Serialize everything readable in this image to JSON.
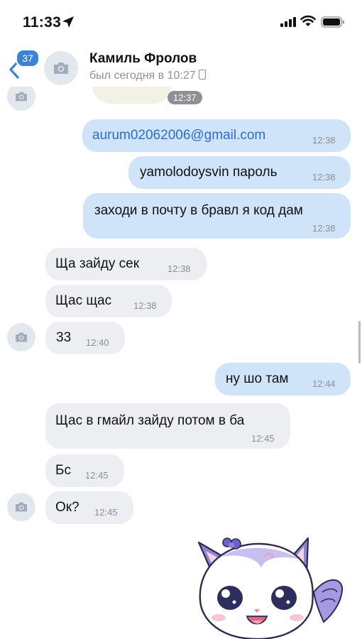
{
  "status_bar": {
    "time": "11:33"
  },
  "header": {
    "unread_badge": "37",
    "contact_name": "Камиль Фролов",
    "last_seen": "был сегодня в 10:27"
  },
  "chat": {
    "sticker_time": "12:37",
    "messages": [
      {
        "text": "aurum02062006@gmail.com",
        "time": "12:38"
      },
      {
        "text": "yamolodoysvin пароль",
        "time": "12:38"
      },
      {
        "text": "заходи в почту в бравл я код дам",
        "time": "12:38"
      },
      {
        "text": "Ща зайду сек",
        "time": "12:38"
      },
      {
        "text": "Щас щас",
        "time": "12:38"
      },
      {
        "text": "33",
        "time": "12:40"
      },
      {
        "text": "ну шо там",
        "time": "12:44"
      },
      {
        "text": "Щас в гмайл зайду потом в ба",
        "time": "12:45"
      },
      {
        "text": "Бс",
        "time": "12:45"
      },
      {
        "text": "Ок?",
        "time": "12:45"
      }
    ]
  },
  "colors": {
    "outgoing": "#cfe3f9",
    "incoming": "#eceef1",
    "accent": "#3b82d8",
    "link": "#2a6fc9"
  }
}
